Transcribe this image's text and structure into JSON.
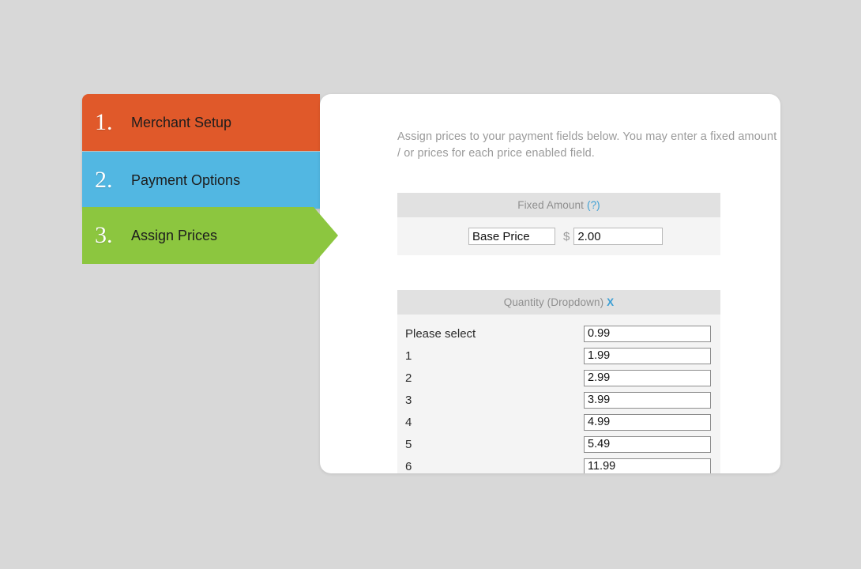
{
  "background_color": "#d8d8d8",
  "steps": [
    {
      "number": "1.",
      "label": "Merchant Setup",
      "color": "#e0592a",
      "state": "inactive"
    },
    {
      "number": "2.",
      "label": "Payment Options",
      "color": "#52b7e2",
      "state": "inactive"
    },
    {
      "number": "3.",
      "label": "Assign Prices",
      "color": "#8cc63f",
      "state": "active"
    }
  ],
  "card": {
    "intro_text": "Assign prices to your payment fields below. You may enter a fixed amount per\n/ or prices for each price enabled field."
  },
  "fixed_amount": {
    "header_label": "Fixed Amount",
    "header_accent": "(?)",
    "name_value": "Base Price",
    "currency_symbol": "$",
    "price_value": "2.00"
  },
  "quantity": {
    "header_label": "Quantity (Dropdown)",
    "header_accent": "X",
    "options": [
      {
        "label": "Please select",
        "price": "0.99"
      },
      {
        "label": "1",
        "price": "1.99"
      },
      {
        "label": "2",
        "price": "2.99"
      },
      {
        "label": "3",
        "price": "3.99"
      },
      {
        "label": "4",
        "price": "4.99"
      },
      {
        "label": "5",
        "price": "5.49"
      },
      {
        "label": "6",
        "price": "11.99"
      }
    ]
  },
  "colors": {
    "accent_blue": "#3d9fd4",
    "section_header_bg": "#e1e1e1",
    "section_body_bg": "#f4f4f4"
  }
}
